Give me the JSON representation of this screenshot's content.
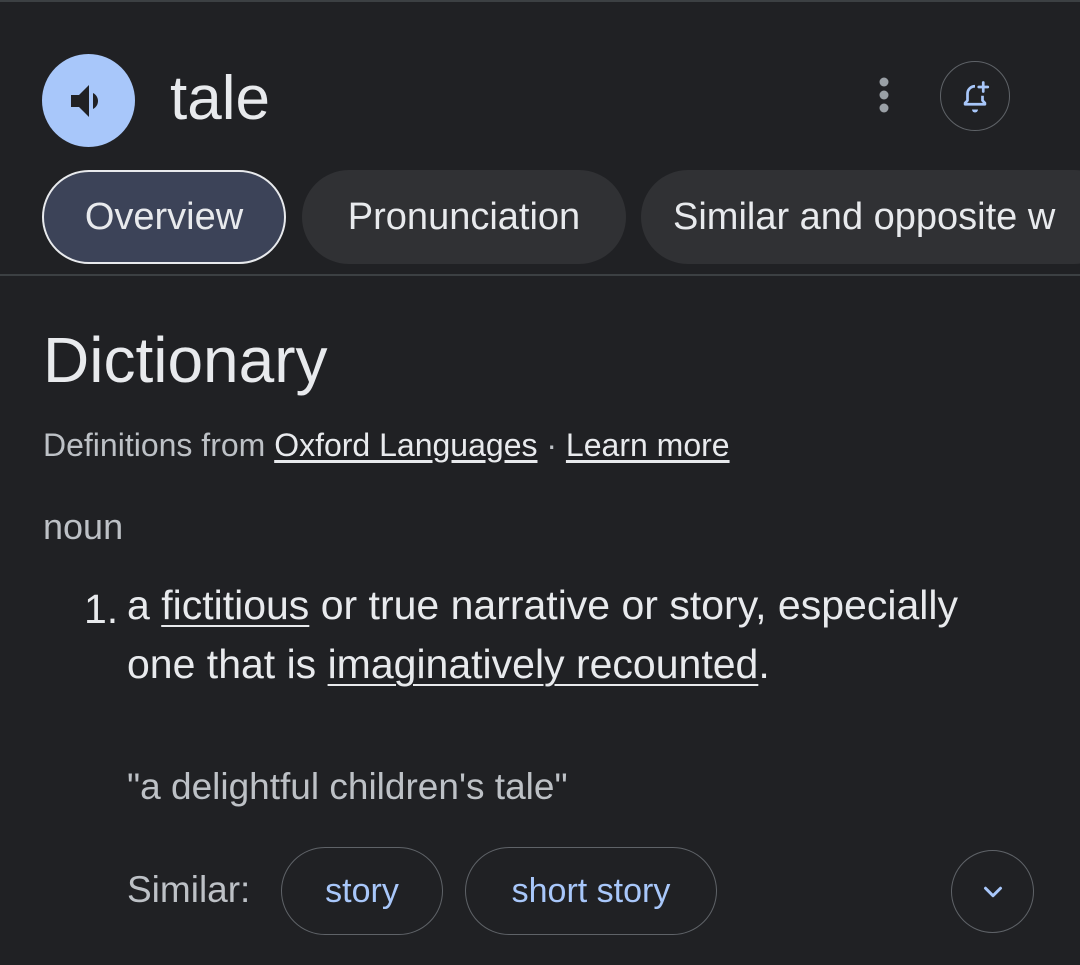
{
  "header": {
    "word": "tale",
    "speaker_icon": "volume-icon",
    "more_icon": "more-vert-icon",
    "alert_icon": "add-alert-icon"
  },
  "tabs": [
    {
      "label": "Overview",
      "active": true
    },
    {
      "label": "Pronunciation",
      "active": false
    },
    {
      "label": "Similar and opposite w",
      "active": false
    }
  ],
  "dictionary": {
    "title": "Dictionary",
    "source_prefix": "Definitions from",
    "source_link": "Oxford Languages",
    "separator": "·",
    "learn_more": "Learn more",
    "part_of_speech": "noun",
    "definitions": [
      {
        "number": "1.",
        "text_1": "a ",
        "link_1": "fictitious",
        "text_2": " or true narrative or story, especially one that is ",
        "link_2": "imaginatively recounted",
        "text_3": ".",
        "example": "\"a delightful children's tale\""
      }
    ],
    "similar_label": "Similar:",
    "similar": [
      "story",
      "short story"
    ],
    "expand_icon": "chevron-down-icon"
  },
  "colors": {
    "background": "#202124",
    "accent": "#a8c7fa",
    "text": "#e8eaed",
    "muted": "#bdc1c6"
  }
}
